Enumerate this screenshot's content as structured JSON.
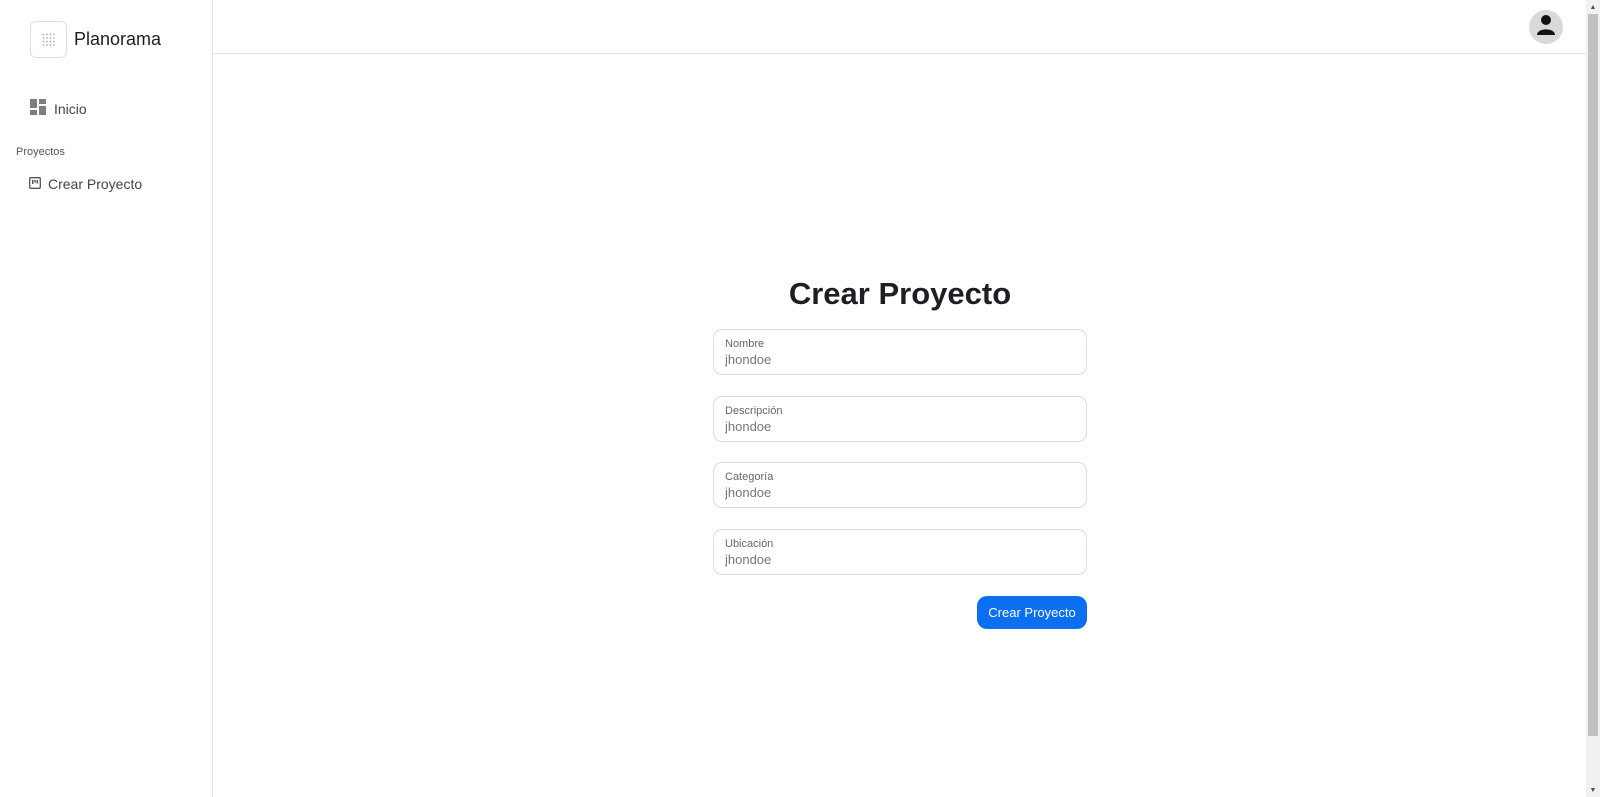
{
  "app": {
    "name": "Planorama"
  },
  "sidebar": {
    "items": [
      {
        "label": "Inicio",
        "icon": "dashboard-icon"
      }
    ],
    "section": {
      "label": "Proyectos",
      "items": [
        {
          "label": "Crear Proyecto",
          "icon": "board-icon"
        }
      ]
    }
  },
  "header": {
    "avatar_icon": "user-icon"
  },
  "form": {
    "title": "Crear Proyecto",
    "fields": [
      {
        "label": "Nombre",
        "placeholder": "jhondoe"
      },
      {
        "label": "Descripción",
        "placeholder": "jhondoe"
      },
      {
        "label": "Categoría",
        "placeholder": "jhondoe"
      },
      {
        "label": "Ubicación",
        "placeholder": "jhondoe"
      }
    ],
    "submit_label": "Crear Proyecto"
  },
  "colors": {
    "accent": "#0b6ff0",
    "border": "#dcdcdc"
  }
}
